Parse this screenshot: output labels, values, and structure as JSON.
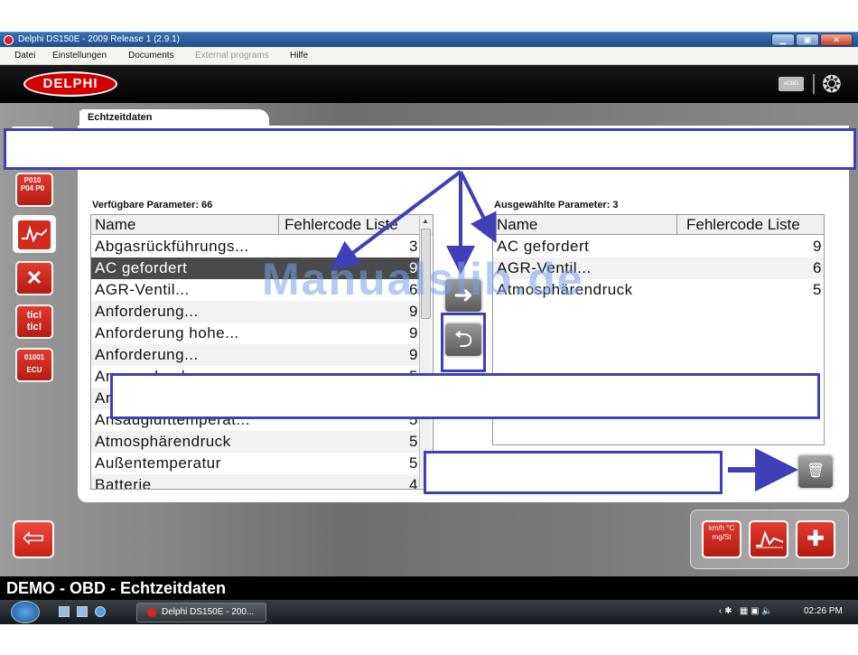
{
  "window": {
    "title": "Delphi DS150E - 2009 Release 1 (2.9.1)",
    "minimize_glyph": "▁",
    "maximize_glyph": "▣",
    "close_glyph": "✕"
  },
  "menu": {
    "items": [
      "Datei",
      "Einstellungen",
      "Documents",
      "External programs",
      "Hilfe"
    ]
  },
  "header": {
    "logo_text": "DELPHI",
    "eobd_badge": "eOBD"
  },
  "tab": {
    "label": "Echtzeitdaten"
  },
  "available": {
    "label": "Verfügbare Parameter: 66",
    "col_name": "Name",
    "col_code": "Fehlercode Liste",
    "rows": [
      {
        "name": "Abgasrückführungs...",
        "code": "3"
      },
      {
        "name": "AC gefordert",
        "code": "9"
      },
      {
        "name": "AGR-Ventil...",
        "code": "6"
      },
      {
        "name": "Anforderung...",
        "code": "9"
      },
      {
        "name": "Anforderung hohe...",
        "code": "9"
      },
      {
        "name": "Anforderung...",
        "code": "9"
      },
      {
        "name": "Ansaugdruck",
        "code": "5"
      },
      {
        "name": "An",
        "code": ""
      },
      {
        "name": "Ansauglufttemperat...",
        "code": "5"
      },
      {
        "name": "Atmosphärendruck",
        "code": "5"
      },
      {
        "name": "Außentemperatur",
        "code": "5"
      },
      {
        "name": "Batterie",
        "code": "4"
      }
    ]
  },
  "selected": {
    "label": "Ausgewählte Parameter: 3",
    "col_name": "Name",
    "col_code": "Fehlercode Liste",
    "rows": [
      {
        "name": "AC gefordert",
        "code": "9"
      },
      {
        "name": "AGR-Ventil...",
        "code": "6"
      },
      {
        "name": "Atmosphärendruck",
        "code": "5"
      }
    ]
  },
  "watermark": "Manualslib.de",
  "status": {
    "text": "DEMO - OBD - Echtzeitdaten"
  },
  "sidebar": {
    "dtc_icon_text": "P010 P04 P0",
    "tic_icon_text": "tic! tic!",
    "ecu_icon_text": "01001 ECU"
  },
  "toolbar": {
    "units_icon_text": "km/h °C mg/St"
  },
  "taskbar": {
    "task_label": "Delphi DS150E - 200...",
    "time": "02:26 PM"
  },
  "colors": {
    "delphi_red": "#d40000",
    "annotation_blue": "#3f3fb7",
    "selected_row": "#4a4a4a"
  }
}
